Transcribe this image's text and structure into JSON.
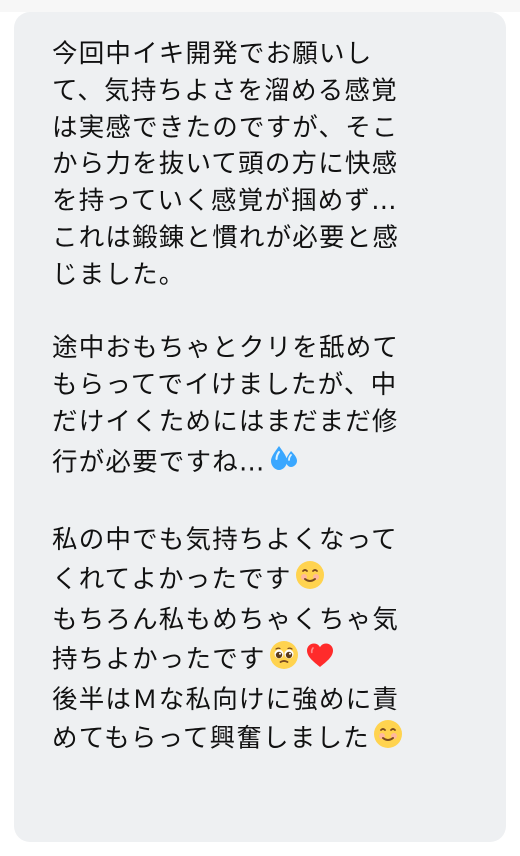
{
  "message": {
    "paragraphs": [
      {
        "lines": [
          "今回中イキ開発でお願いし",
          "て、気持ちよさを溜める感覚",
          "は実感できたのですが、そこ",
          "から力を抜いて頭の方に快感",
          "を持っていく感覚が掴めず…",
          "これは鍛錬と慣れが必要と感",
          "じました。"
        ]
      },
      {
        "lines": [
          "途中おもちゃとクリを舐めて",
          "もらってでイけましたが、中",
          "だけイくためにはまだまだ修",
          "行が必要ですね…"
        ],
        "trailing_emoji": "sweat-droplets-icon"
      },
      {
        "lines": [
          "私の中でも気持ちよくなって",
          "くれてよかったです",
          "もちろん私もめちゃくちゃ気",
          "持ちよかったです",
          "後半はＭな私向けに強めに責",
          "めてもらって興奮しました"
        ],
        "emojis": {
          "line_1": "smiling-face-icon",
          "line_3": [
            "pleading-face-icon",
            "red-heart-icon"
          ],
          "line_5": "smiling-face-icon"
        }
      }
    ]
  },
  "colors": {
    "bubble_background": "#eef0f2",
    "text": "#111111",
    "sweat_drops": "#3aa7ff",
    "heart": "#ff2b2b",
    "face": "#ffd34f"
  }
}
